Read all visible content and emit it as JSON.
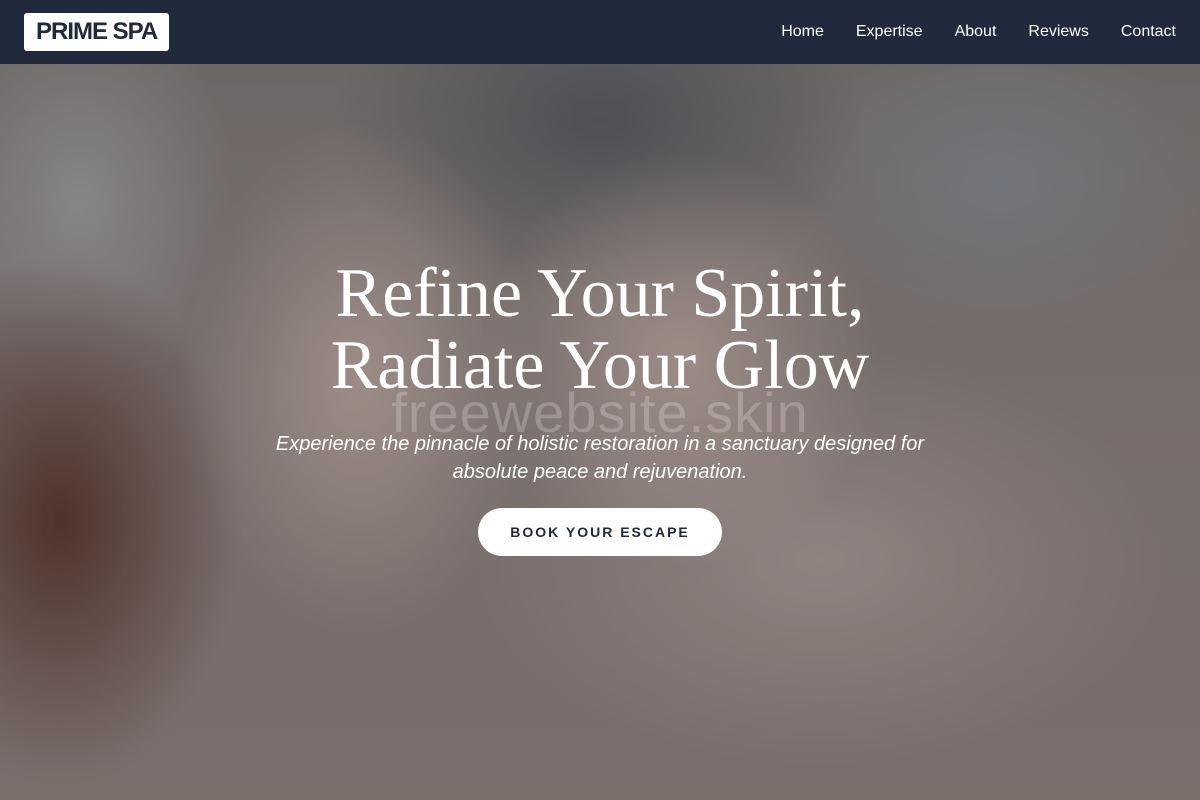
{
  "header": {
    "logo": "PRIME SPA",
    "nav": [
      {
        "label": "Home"
      },
      {
        "label": "Expertise"
      },
      {
        "label": "About"
      },
      {
        "label": "Reviews"
      },
      {
        "label": "Contact"
      }
    ]
  },
  "hero": {
    "title_line1": "Refine Your Spirit,",
    "title_line2": "Radiate Your Glow",
    "subtitle": "Experience the pinnacle of holistic restoration in a sanctuary designed for absolute peace and rejuvenation.",
    "cta_label": "BOOK YOUR ESCAPE",
    "watermark": "freewebsite.skin"
  },
  "colors": {
    "nav_bg": "#202a3c",
    "text_primary": "#ffffff",
    "button_bg": "#ffffff",
    "button_text": "#202a3c"
  }
}
